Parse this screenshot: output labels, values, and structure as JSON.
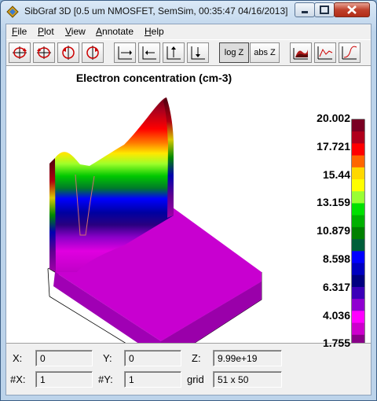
{
  "window": {
    "title": "SibGraf 3D [0.5 um NMOSFET, SemSim, 00:35:47 04/16/2013]"
  },
  "menu": [
    "File",
    "Plot",
    "View",
    "Annotate",
    "Help"
  ],
  "toolbar": {
    "rotate_buttons": [
      "rotate-x-icon",
      "rotate-y-icon",
      "rotate-z-icon",
      "rotate-z-reverse-icon"
    ],
    "axis_buttons": [
      "axis-x-right-icon",
      "axis-x-left-icon",
      "axis-z-up-icon",
      "axis-z-down-icon"
    ],
    "log_z_label": "log Z",
    "abs_z_label": "abs Z",
    "view_buttons": [
      "surface-view-icon",
      "profile-x-icon",
      "profile-y-icon"
    ]
  },
  "plot": {
    "title": "Electron concentration (cm-3)",
    "colorbar": {
      "tick_labels": [
        "20.002",
        "17.721",
        "15.44",
        "13.159",
        "10.879",
        "8.598",
        "6.317",
        "4.036",
        "1.755"
      ],
      "colors": [
        "#7a0022",
        "#b0001c",
        "#ff0000",
        "#ff6600",
        "#ffd800",
        "#ffff00",
        "#99ff33",
        "#00e000",
        "#00b000",
        "#008000",
        "#005e3a",
        "#0000ff",
        "#0000c0",
        "#000080",
        "#3a00b8",
        "#9000d0",
        "#ff00ff",
        "#cc00cc",
        "#880088"
      ]
    }
  },
  "status": {
    "x_label": "X:",
    "x_value": "0",
    "y_label": "Y:",
    "y_value": "0",
    "z_label": "Z:",
    "z_value": "9.99e+19",
    "nx_label": "#X:",
    "nx_value": "1",
    "ny_label": "#Y:",
    "ny_value": "1",
    "grid_label": "grid",
    "grid_value": "51 x 50"
  }
}
